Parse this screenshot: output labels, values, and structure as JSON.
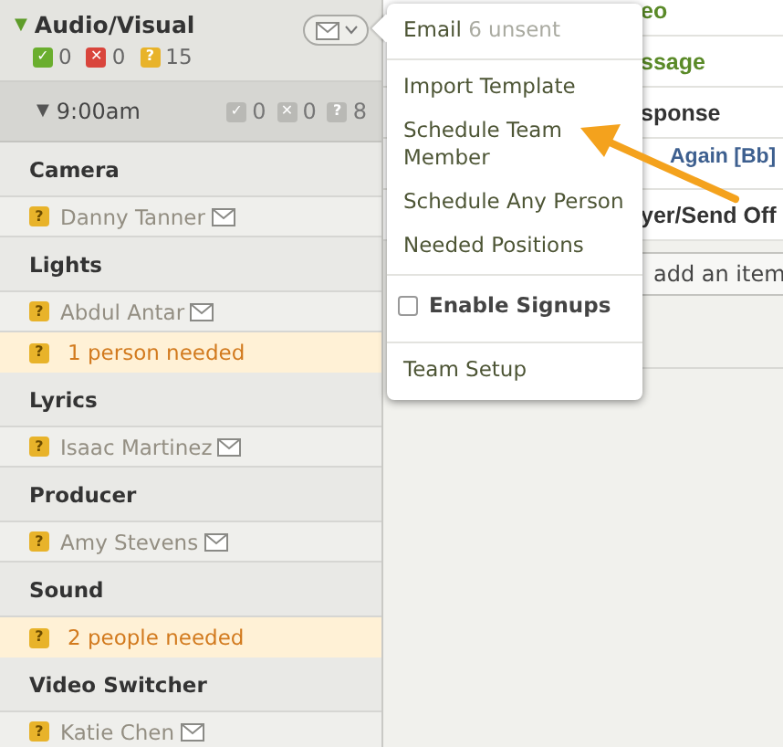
{
  "section": {
    "toggle": "▼",
    "title": "Audio/Visual",
    "counts": [
      {
        "kind": "confirmed",
        "icon": "✓",
        "count": "0"
      },
      {
        "kind": "declined",
        "icon": "✕",
        "count": "0"
      },
      {
        "kind": "unconfirmed",
        "icon": "?",
        "count": "15"
      }
    ]
  },
  "time": {
    "toggle": "▼",
    "label": "9:00am",
    "counts": [
      {
        "icon": "✓",
        "count": "0"
      },
      {
        "icon": "✕",
        "count": "0"
      },
      {
        "icon": "?",
        "count": "8"
      }
    ]
  },
  "positions": [
    {
      "name": "Camera",
      "rows": [
        {
          "kind": "person",
          "icon": "?",
          "text": "Danny Tanner"
        }
      ]
    },
    {
      "name": "Lights",
      "rows": [
        {
          "kind": "person",
          "icon": "?",
          "text": "Abdul Antar"
        },
        {
          "kind": "needed",
          "icon": "?",
          "text": "1 person needed"
        }
      ]
    },
    {
      "name": "Lyrics",
      "rows": [
        {
          "kind": "person",
          "icon": "?",
          "text": "Isaac Martinez"
        }
      ]
    },
    {
      "name": "Producer",
      "rows": [
        {
          "kind": "person",
          "icon": "?",
          "text": "Amy Stevens"
        }
      ]
    },
    {
      "name": "Sound",
      "rows": [
        {
          "kind": "needed",
          "icon": "?",
          "text": "2 people needed"
        }
      ]
    },
    {
      "name": "Video Switcher",
      "rows": [
        {
          "kind": "person",
          "icon": "?",
          "text": "Katie Chen"
        }
      ]
    }
  ],
  "plan_items": [
    {
      "kind": "song",
      "text": "eo"
    },
    {
      "kind": "song",
      "text": "ssage"
    },
    {
      "kind": "item",
      "text": "sponse"
    },
    {
      "kind": "link",
      "text": "Again [Bb]"
    },
    {
      "kind": "item",
      "text": "yer/Send Off"
    }
  ],
  "add_button": "add an item",
  "menu": {
    "items": [
      {
        "kind": "email",
        "label": "Email",
        "note": "6 unsent"
      },
      {
        "kind": "separator"
      },
      {
        "kind": "action",
        "label": "Import Template"
      },
      {
        "kind": "action",
        "label": "Schedule Team Member"
      },
      {
        "kind": "action",
        "label": "Schedule Any Person"
      },
      {
        "kind": "action",
        "label": "Needed Positions"
      },
      {
        "kind": "separator"
      },
      {
        "kind": "checkbox",
        "label": "Enable Signups",
        "checked": false
      },
      {
        "kind": "separator"
      },
      {
        "kind": "action",
        "label": "Team Setup"
      }
    ]
  }
}
